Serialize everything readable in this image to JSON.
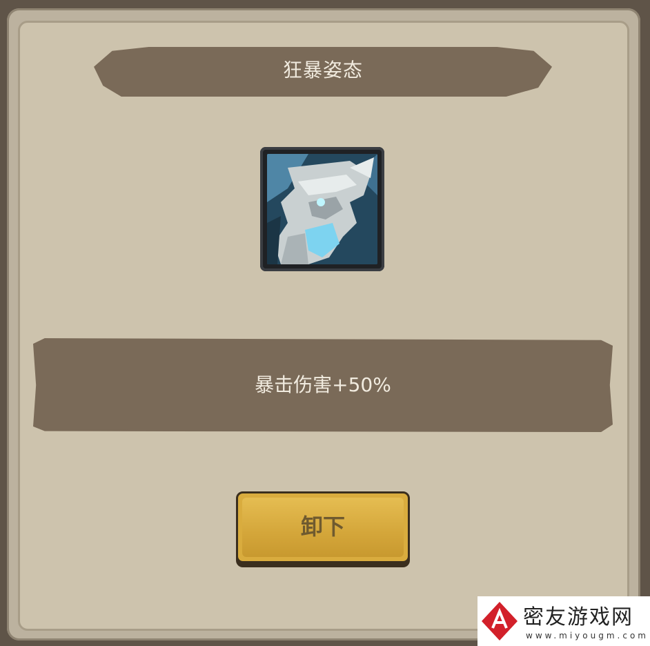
{
  "dialog": {
    "title": "狂暴姿态",
    "skill_icon": "bearded-warrior-skill-icon",
    "description": "暴击伤害+50%",
    "unequip_label": "卸下"
  },
  "watermark": {
    "site_name": "密友游戏网",
    "url": "www.miyougm.com"
  },
  "colors": {
    "panel_bg": "#cdc3ad",
    "banner_bg": "#7a6a58",
    "button_gold": "#d9ac3e",
    "text_light": "#f1ebdf"
  }
}
